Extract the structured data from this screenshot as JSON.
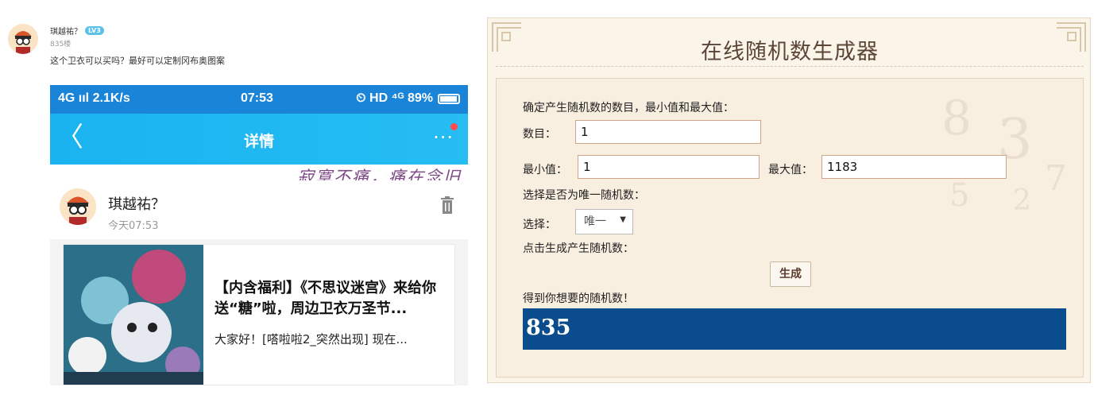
{
  "post": {
    "author": "琪越祐？",
    "level": "LV3",
    "floor": "835楼",
    "text": "这个卫衣可以买吗？最好可以定制冈布奥图案"
  },
  "phone": {
    "status": {
      "network": "4G ııl 2.1K/s",
      "time": "07:53",
      "right": "⏲ HD ⁴ᴳ 89%"
    },
    "nav": {
      "back": "〈",
      "title": "详情",
      "more": "···"
    },
    "banner": "寂寞不痛，痛在念旧",
    "card": {
      "name": "琪越祐？",
      "time": "今天07:53"
    },
    "article": {
      "title": "【内含福利】《不思议迷宫》来给你送“糖”啦，周边卫衣万圣节...",
      "summary": "大家好！[嗒啦啦2_突然出现] 现在..."
    }
  },
  "generator": {
    "title": "在线随机数生成器",
    "intro": "确定产生随机数的数目，最小值和最大值：",
    "count_label": "数目：",
    "count_value": "1",
    "min_label": "最小值：",
    "min_value": "1",
    "max_label": "最大值：",
    "max_value": "1183",
    "unique_prompt": "选择是否为唯一随机数：",
    "select_label": "选择：",
    "select_value": "唯一",
    "generate_prompt": "点击生成产生随机数：",
    "generate_button": "生成",
    "result_label": "得到你想要的随机数！",
    "result_value": "835"
  }
}
